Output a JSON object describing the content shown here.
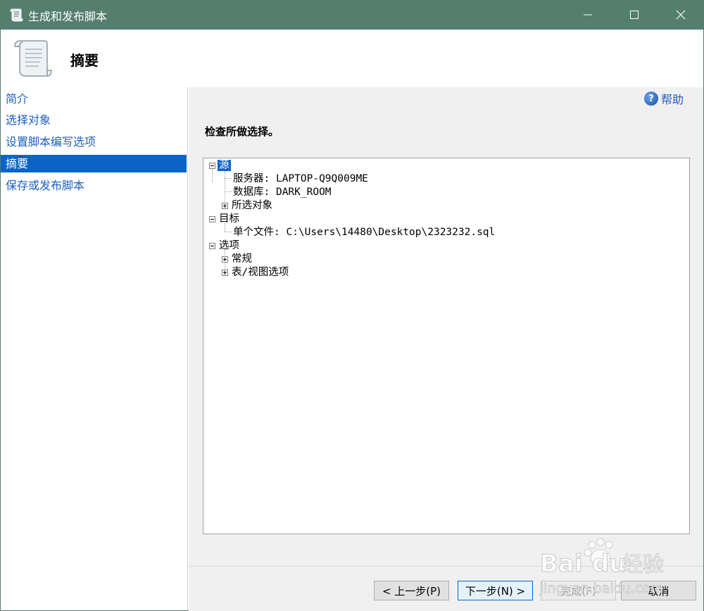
{
  "window": {
    "title": "生成和发布脚本",
    "minimize_icon": "minimize-icon",
    "maximize_icon": "maximize-icon",
    "close_icon": "close-icon"
  },
  "header": {
    "title": "摘要",
    "icon": "scroll-icon"
  },
  "sidebar": {
    "items": [
      {
        "label": "简介",
        "selected": false
      },
      {
        "label": "选择对象",
        "selected": false
      },
      {
        "label": "设置脚本编写选项",
        "selected": false
      },
      {
        "label": "摘要",
        "selected": true
      },
      {
        "label": "保存或发布脚本",
        "selected": false
      }
    ]
  },
  "main": {
    "help_label": "帮助",
    "section_title": "检查所做选择。"
  },
  "tree": {
    "source": "源",
    "server": "服务器: LAPTOP-Q9Q009ME",
    "database": "数据库: DARK_ROOM",
    "selected_objects": "所选对象",
    "target": "目标",
    "single_file": "单个文件: C:\\Users\\14480\\Desktop\\2323232.sql",
    "options": "选项",
    "general": "常规",
    "table_view_options": "表/视图选项"
  },
  "footer": {
    "prev_label": "< 上一步(P)",
    "next_label": "下一步(N) >",
    "finish_label": "完成(F)",
    "cancel_label": "取消"
  },
  "watermark": {
    "brand": "Bai",
    "brand2": "du",
    "text": "经验",
    "url": "jingyan.baidu.com"
  },
  "colors": {
    "titlebar": "#547e6e",
    "selection": "#0a64c8",
    "link": "#1e5fc2"
  }
}
